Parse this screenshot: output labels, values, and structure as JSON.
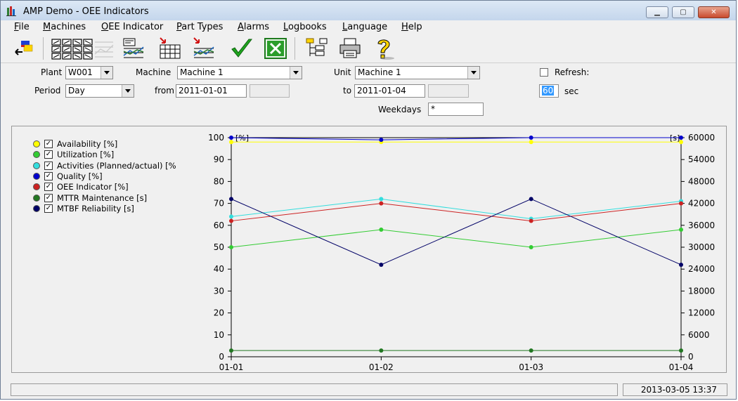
{
  "window": {
    "title": "AMP Demo - OEE Indicators"
  },
  "menu": [
    {
      "label": "File",
      "key": "F",
      "rest": "ile"
    },
    {
      "label": "Machines",
      "key": "M",
      "rest": "achines"
    },
    {
      "label": "OEE Indicator",
      "key": "O",
      "rest": "EE Indicator"
    },
    {
      "label": "Part Types",
      "key": "P",
      "rest": "art Types"
    },
    {
      "label": "Alarms",
      "key": "A",
      "rest": "larms"
    },
    {
      "label": "Logbooks",
      "key": "L",
      "rest": "ogbooks"
    },
    {
      "label": "Language",
      "key": "L",
      "rest": "anguage"
    },
    {
      "label": "Help",
      "key": "H",
      "rest": "elp"
    }
  ],
  "toolbar": {
    "icons": [
      "exit-icon",
      "machines-grid-icon",
      "machines-grid-alt-icon",
      "chart-disabled-icon",
      "chart-table-icon",
      "table-export-icon",
      "chart-export-icon",
      "checkmark-icon",
      "excel-icon",
      "tree-view-icon",
      "printer-icon",
      "help-icon"
    ]
  },
  "filters": {
    "plant_label": "Plant",
    "plant_value": "W001",
    "machine_label": "Machine",
    "machine_value": "Machine 1",
    "unit_label": "Unit",
    "unit_value": "Machine 1",
    "refresh_label": "Refresh:",
    "period_label": "Period",
    "period_value": "Day",
    "from_label": "from",
    "from_value": "2011-01-01",
    "to_label": "to",
    "to_value": "2011-01-04",
    "refresh_seconds": "60",
    "sec_label": "sec",
    "weekdays_label": "Weekdays",
    "weekdays_value": "*"
  },
  "legend": [
    {
      "label": "Availability [%]",
      "color": "#ffff00"
    },
    {
      "label": "Utilization [%]",
      "color": "#33cc33"
    },
    {
      "label": "Activities (Planned/actual) [%",
      "color": "#33dddd"
    },
    {
      "label": "Quality [%]",
      "color": "#0000cc"
    },
    {
      "label": "OEE Indicator [%]",
      "color": "#cc2222"
    },
    {
      "label": "MTTR Maintenance [s]",
      "color": "#227722"
    },
    {
      "label": "MTBF Reliability [s]",
      "color": "#000066"
    }
  ],
  "chart_data": {
    "type": "line",
    "x": [
      "01-01",
      "01-02",
      "01-03",
      "01-04"
    ],
    "y_left_ticks": [
      "0",
      "10",
      "20",
      "30",
      "40",
      "50",
      "60",
      "70",
      "80",
      "90",
      "100"
    ],
    "y_right_ticks": [
      "0",
      "6000",
      "12000",
      "18000",
      "24000",
      "30000",
      "36000",
      "42000",
      "48000",
      "54000",
      "60000"
    ],
    "ylim_left": [
      0,
      100
    ],
    "ylim_right": [
      0,
      60000
    ],
    "left_unit": "[%]",
    "right_unit": "[s]",
    "grid": false,
    "series": [
      {
        "name": "Availability [%]",
        "axis": "left",
        "color": "#ffff00",
        "values": [
          98,
          98,
          98,
          98
        ]
      },
      {
        "name": "Utilization [%]",
        "axis": "left",
        "color": "#33cc33",
        "values": [
          50,
          58,
          50,
          58
        ]
      },
      {
        "name": "Activities (Planned/actual) [%]",
        "axis": "left",
        "color": "#33dddd",
        "values": [
          64,
          72,
          63,
          71
        ]
      },
      {
        "name": "Quality [%]",
        "axis": "left",
        "color": "#0000cc",
        "values": [
          100,
          99,
          100,
          100
        ]
      },
      {
        "name": "OEE Indicator [%]",
        "axis": "left",
        "color": "#cc2222",
        "values": [
          62,
          70,
          62,
          70
        ]
      },
      {
        "name": "MTTR Maintenance [s]",
        "axis": "right",
        "color": "#227722",
        "values": [
          1700,
          1700,
          1700,
          1700
        ]
      },
      {
        "name": "MTBF Reliability [s]",
        "axis": "right",
        "color": "#000066",
        "values": [
          43200,
          25200,
          43200,
          25200
        ]
      }
    ]
  },
  "status": {
    "left_text": "",
    "datetime": "2013-03-05  13:37"
  }
}
